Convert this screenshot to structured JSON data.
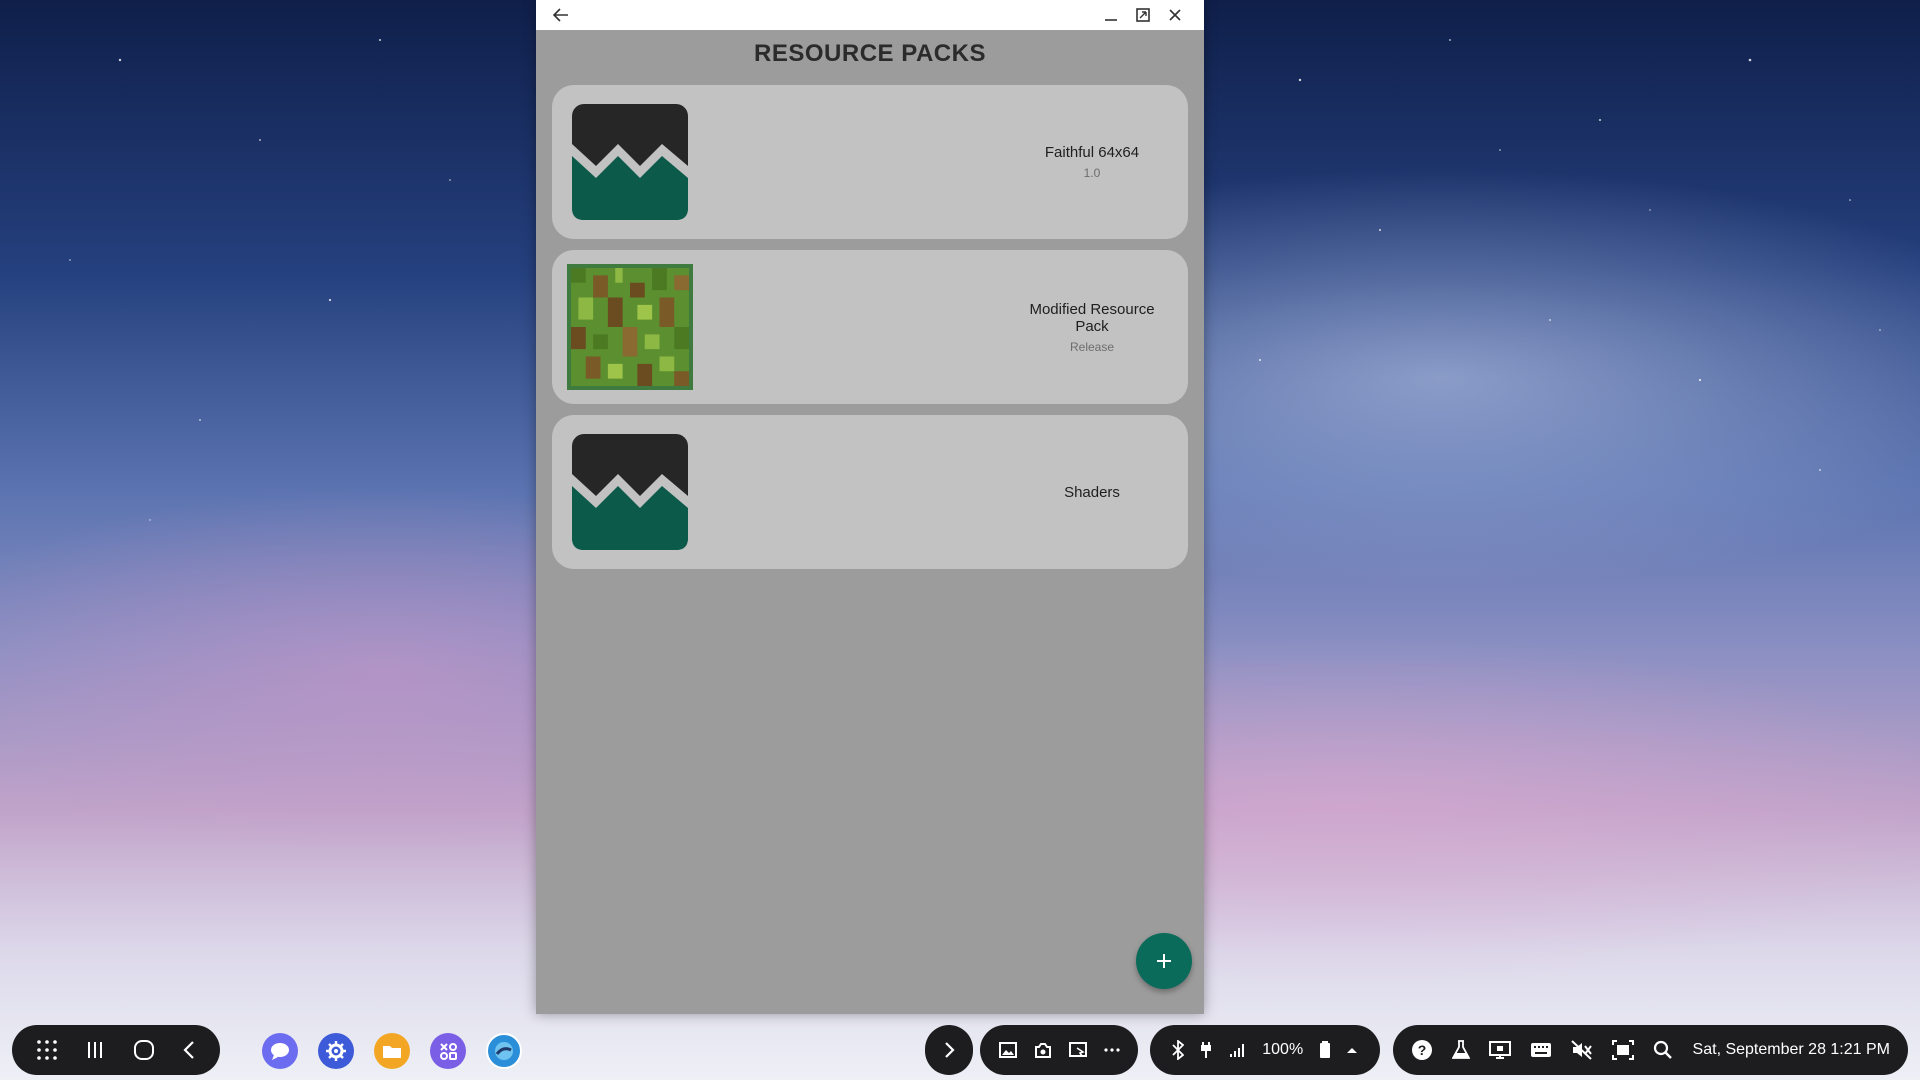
{
  "window": {
    "title": "RESOURCE PACKS"
  },
  "packs": [
    {
      "name": "Faithful 64x64",
      "version": "1.0",
      "icon": "placeholder-pack-icon"
    },
    {
      "name": "Modified Resource Pack",
      "version": "Release",
      "icon": "grass-block-icon"
    },
    {
      "name": "Shaders",
      "version": "",
      "icon": "placeholder-pack-icon"
    }
  ],
  "fab": {
    "icon": "plus-icon"
  },
  "taskbar": {
    "battery": "100%",
    "datetime": "Sat, September 28 1:21 PM"
  },
  "colors": {
    "accent": "#0b6b5a",
    "card_bg": "#c2c2c2",
    "window_bg": "#9c9c9c"
  }
}
